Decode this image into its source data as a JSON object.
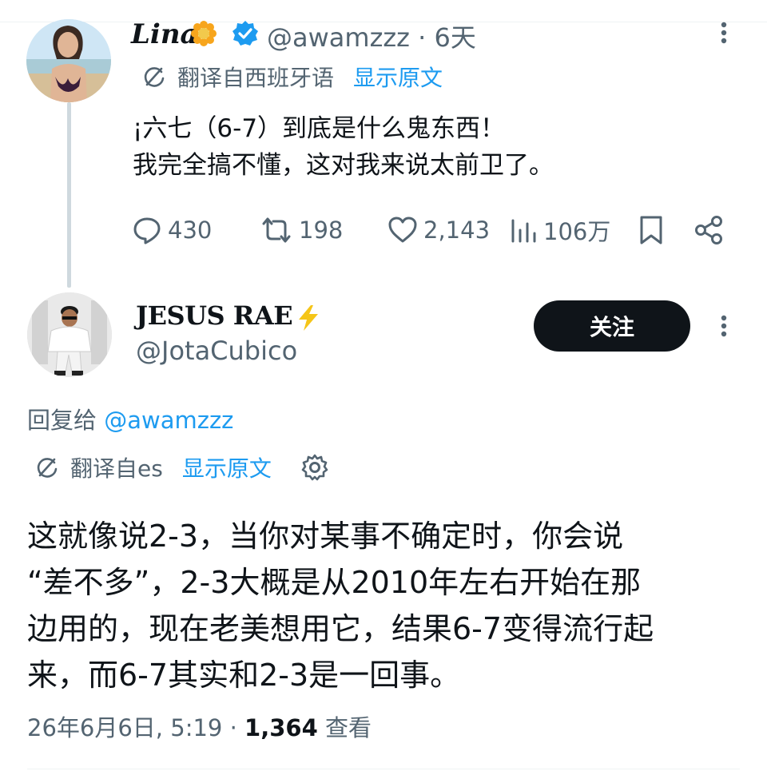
{
  "tweet1": {
    "display_name": "Lina",
    "handle": "@awamzzz",
    "time": "· 6天",
    "translate_label": "翻译自西班牙语",
    "show_original": "显示原文",
    "text": "¡六七（6-7）到底是什么鬼东西！\n我完全搞不懂，这对我来说太前卫了。",
    "actions": {
      "replies": "430",
      "retweets": "198",
      "likes": "2,143",
      "views": "106万"
    }
  },
  "tweet2": {
    "display_name": "JESUS RAE",
    "handle": "@JotaCubico",
    "follow_label": "关注",
    "reply_prefix": "回复给 ",
    "reply_mention": "@awamzzz",
    "translate_label": "翻译自es",
    "show_original": "显示原文",
    "text": "这就像说2-3，当你对某事不确定时，你会说\n“差不多”，2-3大概是从2010年左右开始在那\n边用的，现在老美想用它，结果6-7变得流行起\n来，而6-7其实和2-3是一回事。",
    "date": "26年6月6日, 5:19 · ",
    "views_count": "1,364",
    "views_label": " 查看"
  },
  "icons": [
    "flower-icon",
    "verified-badge-icon",
    "translate-icon",
    "reply-icon",
    "retweet-icon",
    "like-icon",
    "views-icon",
    "bookmark-icon",
    "share-icon",
    "lightning-bolt-icon",
    "gear-icon",
    "more-options-icon"
  ],
  "colors": {
    "text": "#0f1419",
    "secondary": "#536471",
    "link": "#1d9bf0",
    "verified": "#1d9bf0",
    "follow_bg": "#0f1419",
    "bolt": "#f5c518",
    "divider": "#eff3f4",
    "thread_line": "#cfd9de"
  }
}
